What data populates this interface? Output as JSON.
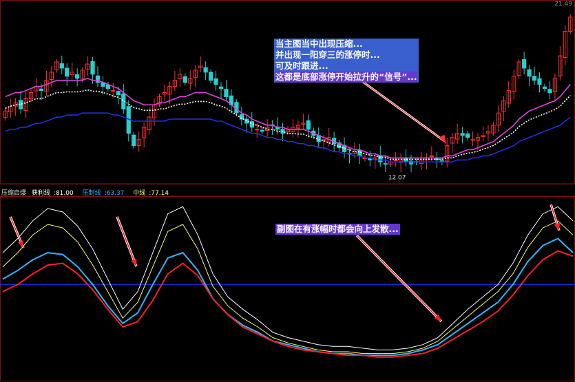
{
  "top_right_label": "21.49",
  "low_label": "12.07",
  "main_annotation": [
    "当主图当中出现压缩...",
    "并出现一阳穿三的涨停时...",
    "可及时跟进...",
    "这都是底部涨停开始拉升的“信号”..."
  ],
  "sub_annotation": "副图在有涨幅时都会向上发散...",
  "indicator_legend": {
    "name": "压缩启爆",
    "items": [
      {
        "label": "获利线",
        "value": "81.00",
        "color": "#ffffff"
      },
      {
        "label": "压制线",
        "value": "63.37",
        "color": "#2fb6ff"
      },
      {
        "label": "中线",
        "value": "77.14",
        "color": "#ffff66"
      },
      {
        "label": "",
        "value": "",
        "color": "#3050ff"
      },
      {
        "label": "",
        "value": "",
        "color": "#ff3030"
      }
    ]
  },
  "colors": {
    "background": "#000000",
    "up": "#ff3030",
    "down": "#26d0d0",
    "ma_magenta": "#e040e0",
    "ma_blue": "#2030e0",
    "ma_white": "#ffffff",
    "ma_yellow": "#ffff66",
    "sub_white": "#ffffff",
    "sub_yellow": "#ffff66",
    "sub_cyan": "#2fb6ff",
    "sub_red": "#ff2020",
    "sub_blue": "#2030ff",
    "annotation_bg": "#3b63d6"
  },
  "chart_data": [
    {
      "type": "candlestick",
      "title": "",
      "closes": [
        16.9,
        17.1,
        17.3,
        17.0,
        17.5,
        17.8,
        18.1,
        17.9,
        18.4,
        18.8,
        19.3,
        19.0,
        18.6,
        18.8,
        18.5,
        18.9,
        19.2,
        18.7,
        18.3,
        18.1,
        18.0,
        17.9,
        17.7,
        17.0,
        15.8,
        15.2,
        15.5,
        16.1,
        16.6,
        17.2,
        17.6,
        17.8,
        18.1,
        18.4,
        18.7,
        18.3,
        18.5,
        18.9,
        19.1,
        18.8,
        18.4,
        18.2,
        18.0,
        17.6,
        17.2,
        16.8,
        16.5,
        16.3,
        16.1,
        16.0,
        15.9,
        16.1,
        16.2,
        16.0,
        15.8,
        16.0,
        16.1,
        16.2,
        16.3,
        16.0,
        15.7,
        15.4,
        15.5,
        15.6,
        15.3,
        15.1,
        14.9,
        14.8,
        14.9,
        14.7,
        14.6,
        14.5,
        14.6,
        14.4,
        14.3,
        14.4,
        14.5,
        14.6,
        14.4,
        14.3,
        14.4,
        14.5,
        14.6,
        14.7,
        14.5,
        14.4,
        15.2,
        15.6,
        15.8,
        15.7,
        15.6,
        15.5,
        15.6,
        15.7,
        15.9,
        16.2,
        16.8,
        17.4,
        17.9,
        18.6,
        19.3,
        19.0,
        18.6,
        18.4,
        18.2,
        18.0,
        17.8,
        18.5,
        19.6,
        20.8,
        21.5
      ],
      "ma_magenta": [
        17.6,
        17.7,
        17.8,
        17.8,
        17.9,
        18.0,
        18.1,
        18.1,
        18.2,
        18.3,
        18.4,
        18.4,
        18.4,
        18.4,
        18.4,
        18.4,
        18.5,
        18.4,
        18.4,
        18.3,
        18.2,
        18.1,
        18.0,
        17.8,
        17.6,
        17.4,
        17.3,
        17.2,
        17.2,
        17.2,
        17.3,
        17.3,
        17.4,
        17.5,
        17.6,
        17.6,
        17.7,
        17.8,
        17.8,
        17.8,
        17.7,
        17.6,
        17.5,
        17.4,
        17.2,
        17.0,
        16.8,
        16.7,
        16.5,
        16.4,
        16.3,
        16.2,
        16.2,
        16.1,
        16.1,
        16.0,
        16.0,
        16.0,
        16.0,
        15.9,
        15.8,
        15.7,
        15.6,
        15.5,
        15.4,
        15.3,
        15.2,
        15.1,
        15.0,
        15.0,
        14.9,
        14.8,
        14.8,
        14.7,
        14.7,
        14.6,
        14.6,
        14.6,
        14.6,
        14.6,
        14.6,
        14.6,
        14.6,
        14.6,
        14.6,
        14.6,
        14.7,
        14.7,
        14.8,
        14.9,
        15.0,
        15.0,
        15.1,
        15.2,
        15.3,
        15.4,
        15.6,
        15.8,
        16.0,
        16.2,
        16.5,
        16.7,
        16.9,
        17.0,
        17.1,
        17.2,
        17.3,
        17.4,
        17.6,
        17.9,
        18.2
      ],
      "ma_blue": [
        15.9,
        16.0,
        16.0,
        16.1,
        16.1,
        16.2,
        16.3,
        16.3,
        16.4,
        16.5,
        16.6,
        16.6,
        16.7,
        16.7,
        16.7,
        16.8,
        16.8,
        16.8,
        16.8,
        16.8,
        16.8,
        16.7,
        16.7,
        16.6,
        16.5,
        16.4,
        16.4,
        16.4,
        16.4,
        16.4,
        16.4,
        16.4,
        16.5,
        16.5,
        16.5,
        16.5,
        16.5,
        16.5,
        16.5,
        16.5,
        16.5,
        16.4,
        16.4,
        16.3,
        16.2,
        16.1,
        16.0,
        15.9,
        15.8,
        15.8,
        15.7,
        15.6,
        15.6,
        15.5,
        15.5,
        15.4,
        15.4,
        15.3,
        15.3,
        15.2,
        15.2,
        15.1,
        15.1,
        15.0,
        14.9,
        14.9,
        14.8,
        14.8,
        14.7,
        14.7,
        14.6,
        14.6,
        14.5,
        14.5,
        14.5,
        14.4,
        14.4,
        14.4,
        14.4,
        14.4,
        14.4,
        14.4,
        14.4,
        14.4,
        14.4,
        14.4,
        14.4,
        14.4,
        14.5,
        14.5,
        14.5,
        14.6,
        14.6,
        14.7,
        14.7,
        14.8,
        14.9,
        15.0,
        15.1,
        15.2,
        15.4,
        15.5,
        15.6,
        15.7,
        15.8,
        15.9,
        16.0,
        16.1,
        16.2,
        16.4,
        16.6
      ],
      "ylim": [
        13.5,
        22.0
      ]
    },
    {
      "type": "line",
      "title": "",
      "series": [
        {
          "name": "获利线",
          "color": "#ffffff",
          "values": [
            70,
            78,
            88,
            95,
            93,
            85,
            72,
            55,
            38,
            48,
            70,
            92,
            96,
            80,
            58,
            45,
            38,
            32,
            25,
            22,
            20,
            18,
            17,
            17,
            16,
            15,
            15,
            16,
            18,
            22,
            30,
            38,
            45,
            52,
            64,
            80,
            92,
            96,
            88
          ]
        },
        {
          "name": "",
          "color": "#ffff66",
          "values": [
            62,
            70,
            80,
            86,
            84,
            76,
            63,
            48,
            33,
            42,
            62,
            82,
            86,
            72,
            51,
            40,
            33,
            28,
            22,
            19,
            17,
            15,
            14,
            14,
            13,
            13,
            13,
            14,
            16,
            20,
            27,
            34,
            41,
            48,
            58,
            73,
            84,
            88,
            80
          ]
        },
        {
          "name": "压制线",
          "color": "#2fb6ff",
          "values": [
            55,
            60,
            66,
            70,
            69,
            62,
            52,
            40,
            30,
            36,
            52,
            67,
            70,
            60,
            44,
            35,
            29,
            25,
            20,
            18,
            16,
            14,
            13,
            13,
            12,
            12,
            12,
            13,
            15,
            18,
            24,
            30,
            36,
            42,
            52,
            65,
            74,
            78,
            70
          ]
        },
        {
          "name": "",
          "color": "#ff2020",
          "values": [
            48,
            52,
            58,
            63,
            64,
            58,
            49,
            38,
            28,
            31,
            43,
            58,
            64,
            57,
            44,
            35,
            28,
            24,
            20,
            17,
            15,
            14,
            13,
            12,
            12,
            11,
            11,
            12,
            13,
            16,
            21,
            26,
            31,
            37,
            46,
            57,
            66,
            71,
            68
          ]
        }
      ],
      "hline": 52,
      "ylim": [
        0,
        100
      ]
    }
  ]
}
